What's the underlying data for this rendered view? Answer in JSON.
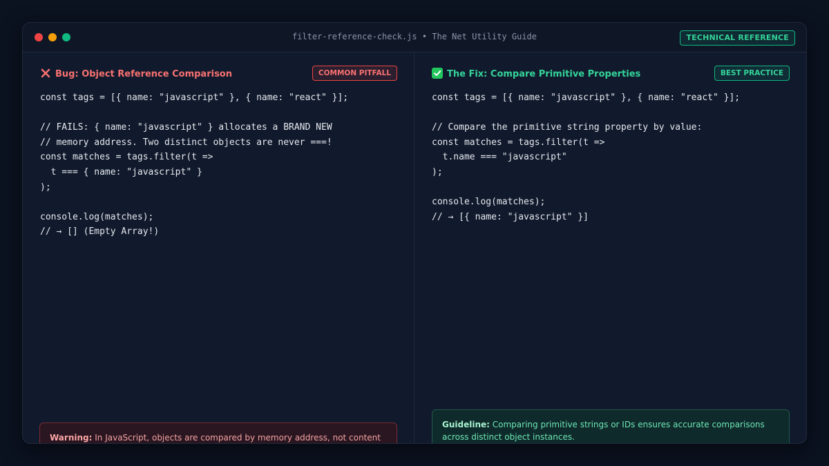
{
  "window": {
    "title": "filter-reference-check.js • The Net Utility Guide",
    "badge": "TECHNICAL REFERENCE"
  },
  "left_panel": {
    "title": "Bug: Object Reference Comparison",
    "icon": "cross-mark-icon",
    "badge": "COMMON PITFALL",
    "code_lines": [
      "const tags = [{ name: \"javascript\" }, { name: \"react\" }];",
      "",
      "// FAILS: { name: \"javascript\" } allocates a BRAND NEW",
      "// memory address. Two distinct objects are never ===!",
      "const matches = tags.filter(t =>",
      "  t === { name: \"javascript\" }",
      ");",
      "",
      "console.log(matches);",
      "// → [] (Empty Array!)"
    ],
    "note_label": "Warning:",
    "note_text": " In JavaScript, objects are compared by memory address, not content value."
  },
  "right_panel": {
    "title": "The Fix: Compare Primitive Properties",
    "icon": "check-mark-icon",
    "badge": "BEST PRACTICE",
    "code_lines": [
      "const tags = [{ name: \"javascript\" }, { name: \"react\" }];",
      "",
      "// Compare the primitive string property by value:",
      "const matches = tags.filter(t =>",
      "  t.name === \"javascript\"",
      ");",
      "",
      "console.log(matches);",
      "// → [{ name: \"javascript\" }]"
    ],
    "note_label": "Guideline:",
    "note_text": " Comparing primitive strings or IDs ensures accurate comparisons across distinct object instances."
  },
  "colors": {
    "error": "#f87171",
    "success": "#34d399",
    "background": "#111a2c"
  }
}
